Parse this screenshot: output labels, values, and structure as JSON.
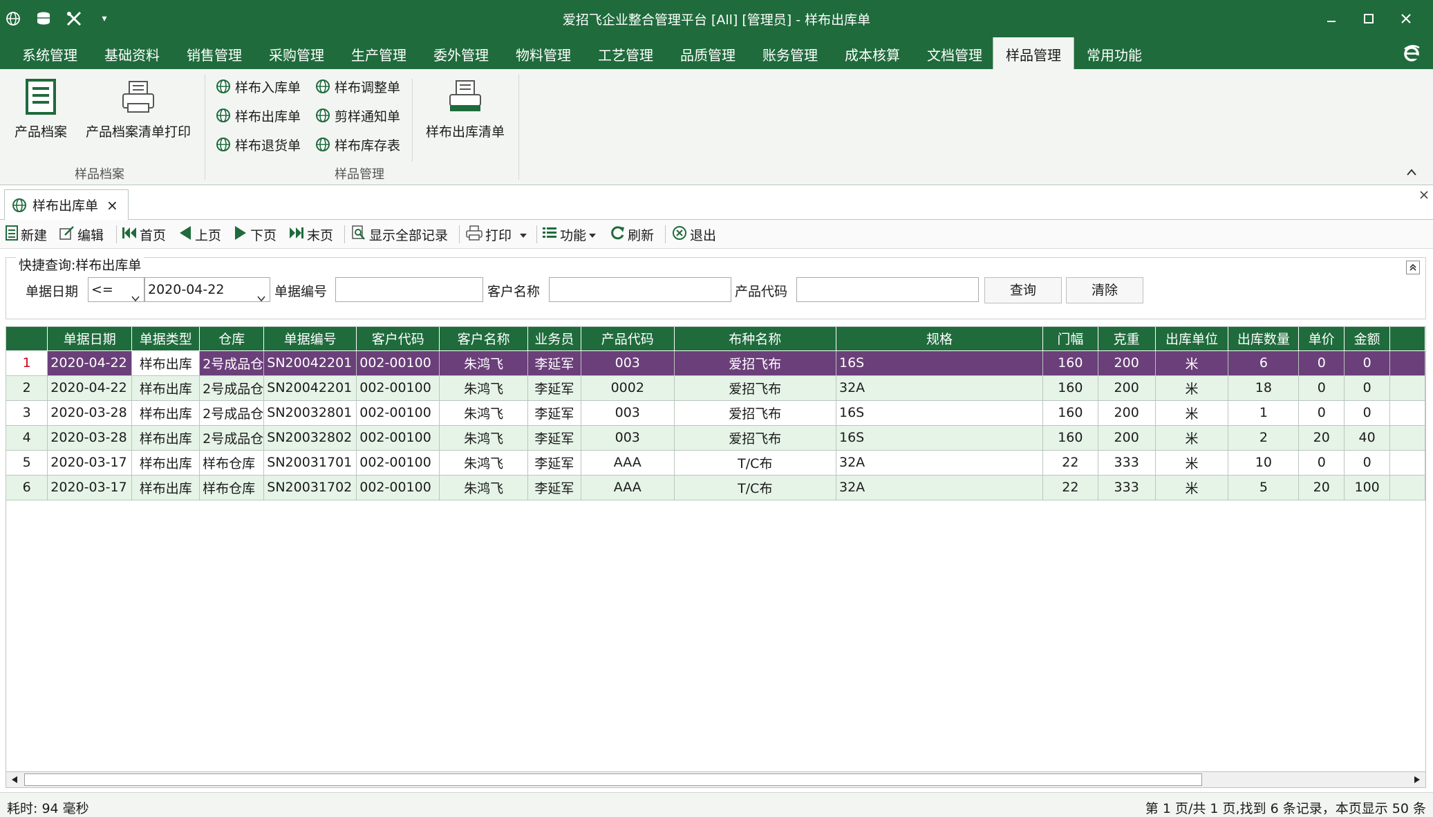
{
  "window": {
    "title": "爱招飞企业整合管理平台 [All] [管理员] - 样布出库单",
    "controls": {
      "minimize": "–",
      "maximize": "☐",
      "close": "✕"
    }
  },
  "menu": {
    "tabs": [
      "系统管理",
      "基础资料",
      "销售管理",
      "采购管理",
      "生产管理",
      "委外管理",
      "物料管理",
      "工艺管理",
      "品质管理",
      "账务管理",
      "成本核算",
      "文档管理",
      "样品管理",
      "常用功能"
    ],
    "active": "样品管理"
  },
  "ribbon": {
    "group1": {
      "label": "样品档案",
      "items": [
        "产品档案",
        "产品档案清单打印"
      ]
    },
    "group2": {
      "label": "样品管理",
      "items": [
        "样布入库单",
        "样布出库单",
        "样布退货单",
        "样布调整单",
        "剪样通知单",
        "样布库存表",
        "样布出库清单"
      ]
    }
  },
  "doc_tab": {
    "label": "样布出库单",
    "close": "×"
  },
  "toolbar": {
    "new": "新建",
    "edit": "编辑",
    "first": "首页",
    "prev": "上页",
    "next": "下页",
    "last": "末页",
    "show_all": "显示全部记录",
    "print": "打印",
    "func": "功能",
    "refresh": "刷新",
    "exit": "退出"
  },
  "query": {
    "title": "快捷查询:样布出库单",
    "date_label": "单据日期",
    "operator": "<=",
    "date_value": "2020-04-22",
    "doc_no_label": "单据编号",
    "customer_label": "客户名称",
    "product_label": "产品代码",
    "search_btn": "查询",
    "clear_btn": "清除"
  },
  "grid": {
    "columns": [
      "单据日期",
      "单据类型",
      "仓库",
      "单据编号",
      "客户代码",
      "客户名称",
      "业务员",
      "产品代码",
      "布种名称",
      "规格",
      "门幅",
      "克重",
      "出库单位",
      "出库数量",
      "单价",
      "金额"
    ],
    "rows": [
      [
        "2020-04-22",
        "样布出库",
        "2号成品仓",
        "SN20042201",
        "002-00100",
        "朱鸿飞",
        "李延军",
        "003",
        "爱招飞布",
        "16S",
        "160",
        "200",
        "米",
        "6",
        "0",
        "0"
      ],
      [
        "2020-04-22",
        "样布出库",
        "2号成品仓",
        "SN20042201",
        "002-00100",
        "朱鸿飞",
        "李延军",
        "0002",
        "爱招飞布",
        "32A",
        "160",
        "200",
        "米",
        "18",
        "0",
        "0"
      ],
      [
        "2020-03-28",
        "样布出库",
        "2号成品仓",
        "SN20032801",
        "002-00100",
        "朱鸿飞",
        "李延军",
        "003",
        "爱招飞布",
        "16S",
        "160",
        "200",
        "米",
        "1",
        "0",
        "0"
      ],
      [
        "2020-03-28",
        "样布出库",
        "2号成品仓",
        "SN20032802",
        "002-00100",
        "朱鸿飞",
        "李延军",
        "003",
        "爱招飞布",
        "16S",
        "160",
        "200",
        "米",
        "2",
        "20",
        "40"
      ],
      [
        "2020-03-17",
        "样布出库",
        "样布仓库",
        "SN20031701",
        "002-00100",
        "朱鸿飞",
        "李延军",
        "AAA",
        "T/C布",
        "32A",
        "22",
        "333",
        "米",
        "10",
        "0",
        "0"
      ],
      [
        "2020-03-17",
        "样布出库",
        "样布仓库",
        "SN20031702",
        "002-00100",
        "朱鸿飞",
        "李延军",
        "AAA",
        "T/C布",
        "32A",
        "22",
        "333",
        "米",
        "5",
        "20",
        "100"
      ]
    ],
    "selected_row": 0
  },
  "status": {
    "left": "耗时: 94 毫秒",
    "right": "第 1 页/共 1 页,找到 6 条记录，本页显示 50 条"
  },
  "colors": {
    "accent": "#1f6b3c",
    "selected": "#6b3f7a",
    "even_row": "#e6f4e8"
  }
}
